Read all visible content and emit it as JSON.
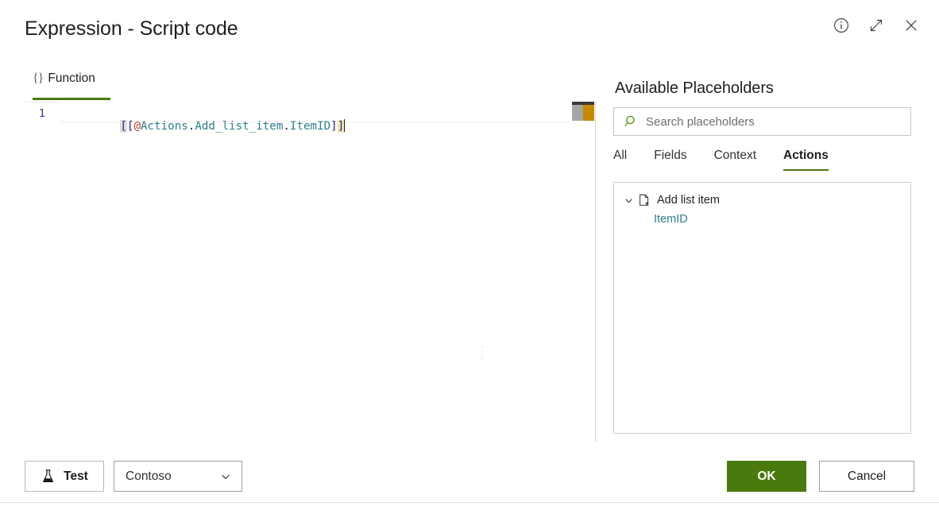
{
  "dialog": {
    "title": "Expression - Script code",
    "header_icons": [
      {
        "name": "info-icon",
        "glyph": "info"
      },
      {
        "name": "expand-icon",
        "glyph": "expand"
      },
      {
        "name": "close-icon",
        "glyph": "close"
      }
    ]
  },
  "editor": {
    "tab_label": "Function",
    "tab_braces": "{}",
    "line_number": "1",
    "code_tokens": [
      {
        "text": "[",
        "type": "bracket-hl"
      },
      {
        "text": "[",
        "type": "bracket"
      },
      {
        "text": "@",
        "type": "at"
      },
      {
        "text": "Actions",
        "type": "ident"
      },
      {
        "text": ".",
        "type": "dot"
      },
      {
        "text": "Add_list_item",
        "type": "ident"
      },
      {
        "text": ".",
        "type": "dot"
      },
      {
        "text": "ItemID",
        "type": "ident"
      },
      {
        "text": "]",
        "type": "bracket"
      },
      {
        "text": "]",
        "type": "bracket-warn"
      }
    ],
    "code_plain": "[[@Actions.Add_list_item.ItemID]]"
  },
  "placeholders": {
    "heading": "Available Placeholders",
    "search": {
      "placeholder": "Search placeholders",
      "value": ""
    },
    "tabs": [
      {
        "label": "All",
        "active": false
      },
      {
        "label": "Fields",
        "active": false
      },
      {
        "label": "Context",
        "active": false
      },
      {
        "label": "Actions",
        "active": true
      }
    ],
    "tree": {
      "group_label": "Add list item",
      "items": [
        {
          "label": "ItemID"
        }
      ]
    }
  },
  "footer": {
    "test_label": "Test",
    "environment_value": "Contoso",
    "ok_label": "OK",
    "cancel_label": "Cancel"
  },
  "colors": {
    "accent_green": "#4a7a0e",
    "search_icon_green": "#5a9216",
    "placeholder_teal": "#2b8091",
    "code_ident_teal": "#2b7f8e",
    "code_at_red": "#c23a2b",
    "code_bracket_blue": "#1f1f7a",
    "ruler_amber": "#c68a00"
  }
}
